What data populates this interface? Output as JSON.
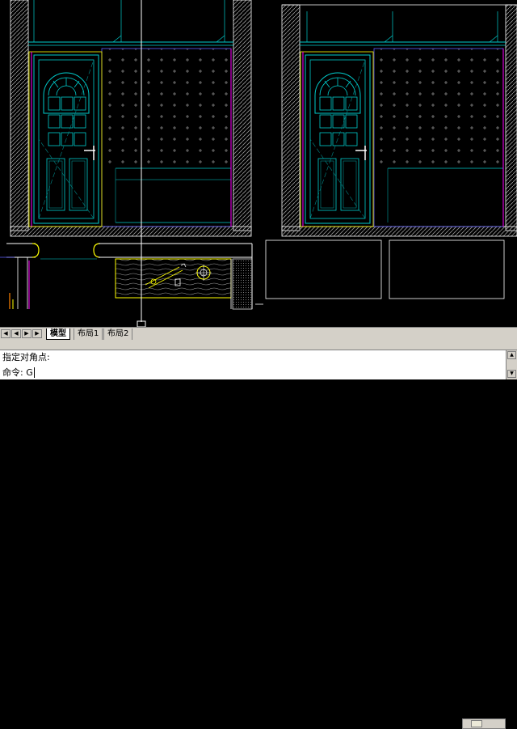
{
  "viewport": {
    "tabs": [
      {
        "label": "模型",
        "active": true
      },
      {
        "label": "布局1",
        "active": false
      },
      {
        "label": "布局2",
        "active": false
      }
    ],
    "nav_icons": [
      "first-icon",
      "prev-icon",
      "next-icon",
      "last-icon"
    ]
  },
  "command": {
    "history_line": "指定对角点:",
    "prompt_label": "命令:",
    "input_value": "G"
  },
  "colors": {
    "background": "#000000",
    "wall_outline": "#ffffff",
    "door_cyan": "#00cccc",
    "magenta": "#ff00ff",
    "yellow": "#ffff00",
    "purple_blue": "#6060ff",
    "dark_cyan_line": "#008b8b",
    "grey_hatch": "#808080"
  }
}
